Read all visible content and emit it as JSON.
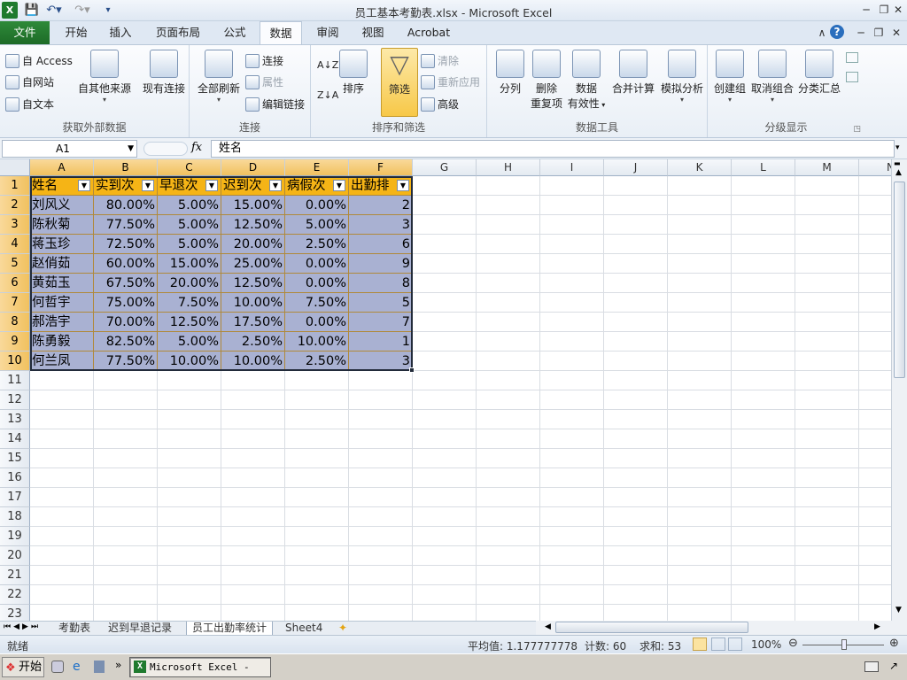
{
  "window": {
    "title": "员工基本考勤表.xlsx - Microsoft Excel"
  },
  "qat": {
    "app_icon": "excel-app-icon",
    "save": "save-icon",
    "undo": "undo-icon",
    "redo": "redo-icon"
  },
  "tabs": [
    "文件",
    "开始",
    "插入",
    "页面布局",
    "公式",
    "数据",
    "审阅",
    "视图",
    "Acrobat"
  ],
  "active_tab": "数据",
  "ribbon": {
    "groups": {
      "external": {
        "label": "获取外部数据",
        "access": "自 Access",
        "web": "自网站",
        "text": "自文本",
        "other": "自其他来源",
        "existing": "现有连接"
      },
      "connections": {
        "label": "连接",
        "refresh": "全部刷新",
        "conn": "连接",
        "props": "属性",
        "edit_links": "编辑链接"
      },
      "sort": {
        "label": "排序和筛选",
        "sort": "排序",
        "filter": "筛选",
        "clear": "清除",
        "reapply": "重新应用",
        "advanced": "高级"
      },
      "tools": {
        "label": "数据工具",
        "split": "分列",
        "remove_dup_1": "删除",
        "remove_dup_2": "重复项",
        "validation_1": "数据",
        "validation_2": "有效性",
        "consolidate": "合并计算",
        "whatif": "模拟分析"
      },
      "outline": {
        "label": "分级显示",
        "group": "创建组",
        "ungroup": "取消组合",
        "subtotal": "分类汇总"
      }
    }
  },
  "formula_bar": {
    "name_box": "A1",
    "fx": "fx",
    "value": "姓名"
  },
  "sheet": {
    "columns": [
      "A",
      "B",
      "C",
      "D",
      "E",
      "F",
      "G",
      "H",
      "I",
      "J",
      "K",
      "L",
      "M",
      "N"
    ],
    "rows": [
      "1",
      "2",
      "3",
      "4",
      "5",
      "6",
      "7",
      "8",
      "9",
      "10",
      "11",
      "12",
      "13",
      "14",
      "15",
      "16",
      "17",
      "18",
      "19",
      "20",
      "21",
      "22",
      "23"
    ],
    "headers": [
      "姓名",
      "实到次",
      "早退次",
      "迟到次",
      "病假次",
      "出勤排"
    ],
    "data": [
      [
        "刘风义",
        "80.00%",
        "5.00%",
        "15.00%",
        "0.00%",
        "2"
      ],
      [
        "陈秋菊",
        "77.50%",
        "5.00%",
        "12.50%",
        "5.00%",
        "3"
      ],
      [
        "蒋玉珍",
        "72.50%",
        "5.00%",
        "20.00%",
        "2.50%",
        "6"
      ],
      [
        "赵俏茹",
        "60.00%",
        "15.00%",
        "25.00%",
        "0.00%",
        "9"
      ],
      [
        "黄茹玉",
        "67.50%",
        "20.00%",
        "12.50%",
        "0.00%",
        "8"
      ],
      [
        "何哲宇",
        "75.00%",
        "7.50%",
        "10.00%",
        "7.50%",
        "5"
      ],
      [
        "郝浩宇",
        "70.00%",
        "12.50%",
        "17.50%",
        "0.00%",
        "7"
      ],
      [
        "陈勇毅",
        "82.50%",
        "5.00%",
        "2.50%",
        "10.00%",
        "1"
      ],
      [
        "何兰凤",
        "77.50%",
        "10.00%",
        "10.00%",
        "2.50%",
        "3"
      ]
    ]
  },
  "sheet_tabs": [
    "考勤表",
    "迟到早退记录",
    "员工出勤率统计",
    "Sheet4"
  ],
  "active_sheet": "员工出勤率统计",
  "status": {
    "ready": "就绪",
    "average": "平均值: 1.177777778",
    "count": "计数: 60",
    "sum": "求和: 53",
    "zoom": "100%"
  },
  "taskbar": {
    "start": "开始",
    "item": "Microsoft Excel - ..."
  },
  "colors": {
    "header_fill": "#f5b416",
    "data_fill": "#a9b1d2",
    "file_tab": "#1d6b27",
    "selection_header": "#f1c15f"
  }
}
